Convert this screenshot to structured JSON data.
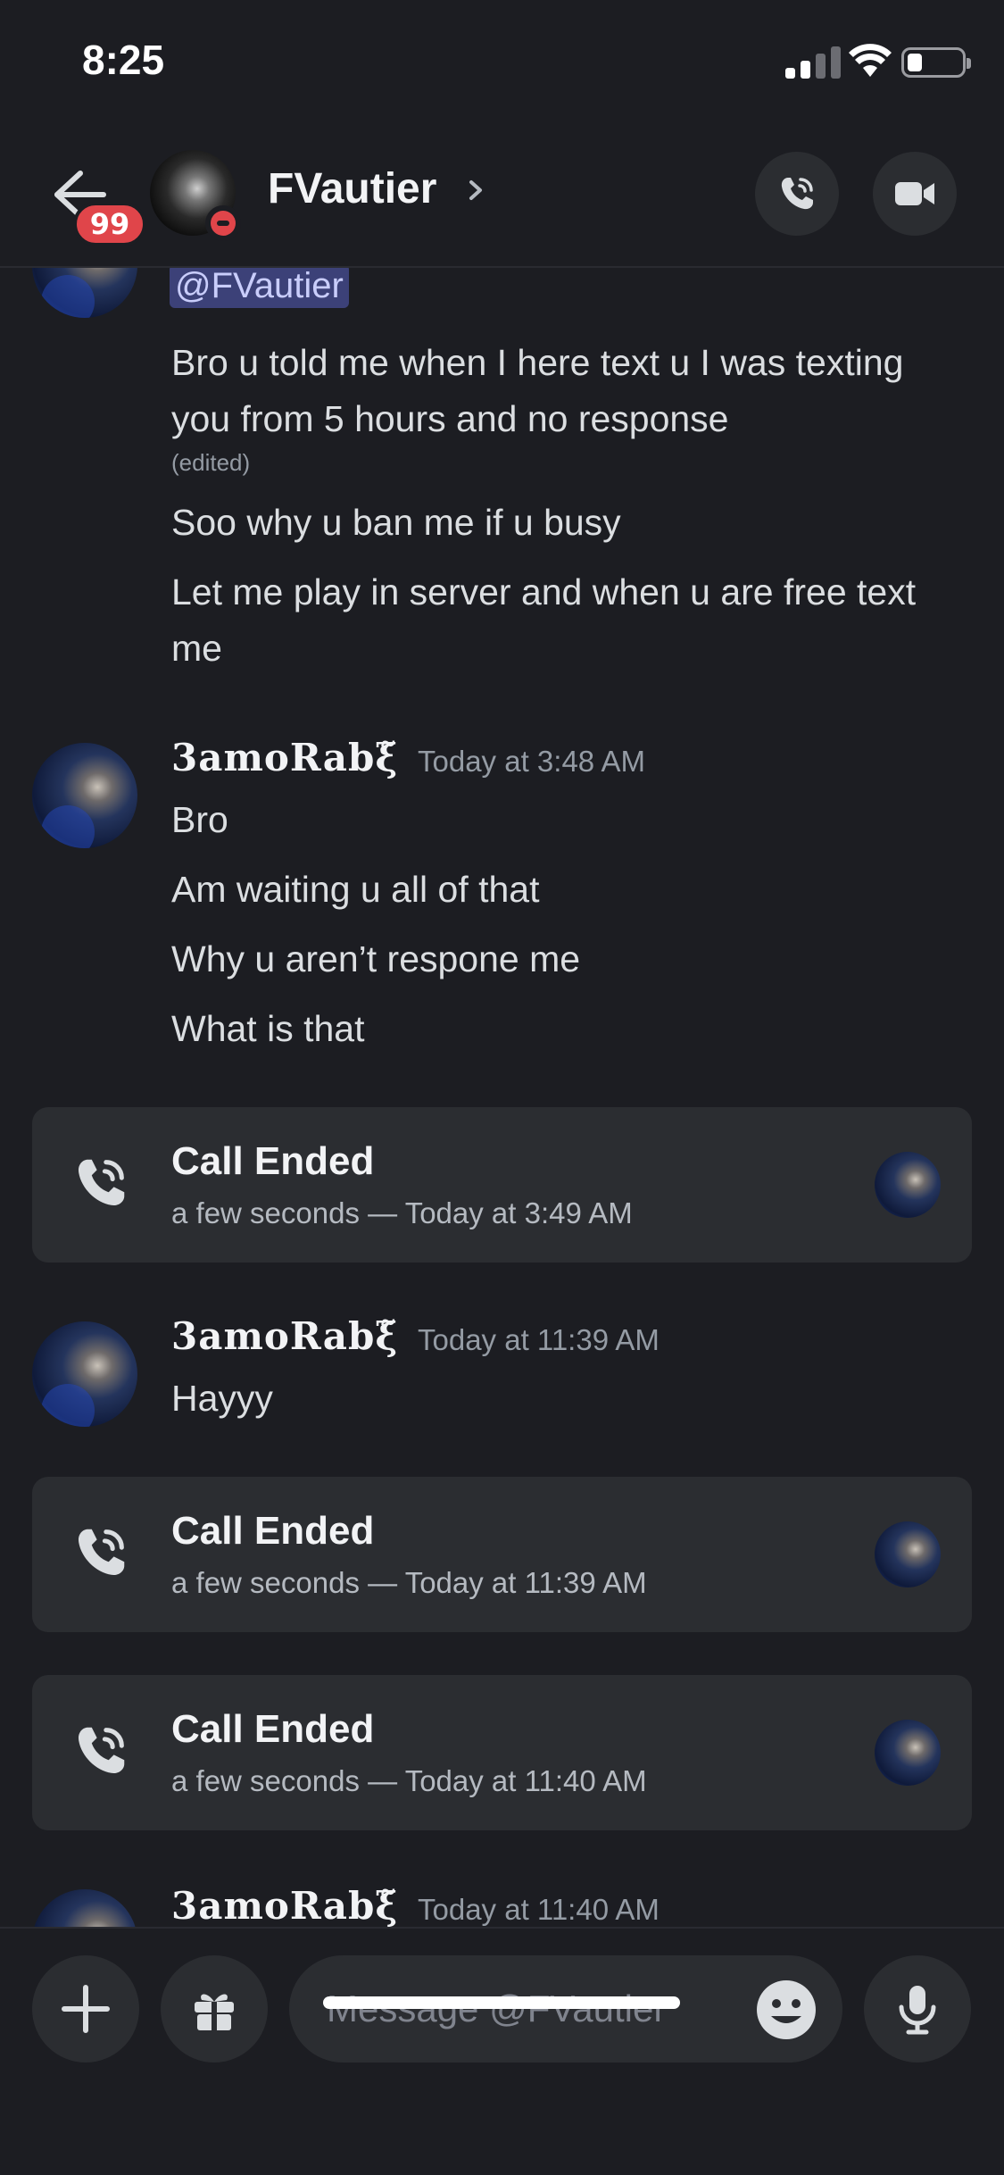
{
  "status_bar": {
    "time": "8:25"
  },
  "header": {
    "badge_count": "99",
    "contact_name": "FVautier",
    "chevron": "›"
  },
  "messages": {
    "mention": "@FVautier",
    "block1": {
      "line1": "Bro u told me when I here text u I was texting you from 5 hours and no response",
      "edited": "(edited)",
      "line2": "Soo why u ban me if u busy",
      "line3": "Let me play in server and when u are free text me"
    },
    "group2": {
      "author": "3amoRabξ̃",
      "time": "Today at 3:48 AM",
      "lines": [
        "Bro",
        "Am waiting u all of that",
        "Why u aren’t respone me",
        "What is that"
      ]
    },
    "call1": {
      "title": "Call Ended",
      "detail": "a few seconds — Today at 3:49 AM"
    },
    "group3": {
      "author": "3amoRabξ̃",
      "time": "Today at 11:39 AM",
      "lines": [
        "Hayyy"
      ]
    },
    "call2": {
      "title": "Call Ended",
      "detail": "a few seconds — Today at 11:39 AM"
    },
    "call3": {
      "title": "Call Ended",
      "detail": "a few seconds — Today at 11:40 AM"
    },
    "group4": {
      "author": "3amoRabξ̃",
      "time": "Today at 11:40 AM"
    }
  },
  "composer": {
    "placeholder": "Message @FVautier"
  },
  "icons": {
    "back": "back-arrow-icon",
    "call": "phone-icon",
    "video": "video-camera-icon",
    "plus": "plus-icon",
    "gift": "gift-icon",
    "emoji": "emoji-icon",
    "mic": "microphone-icon"
  },
  "colors": {
    "background": "#1c1d22",
    "card": "#2b2d31",
    "dnd": "#e0454a",
    "mention_bg": "#3c4178"
  }
}
